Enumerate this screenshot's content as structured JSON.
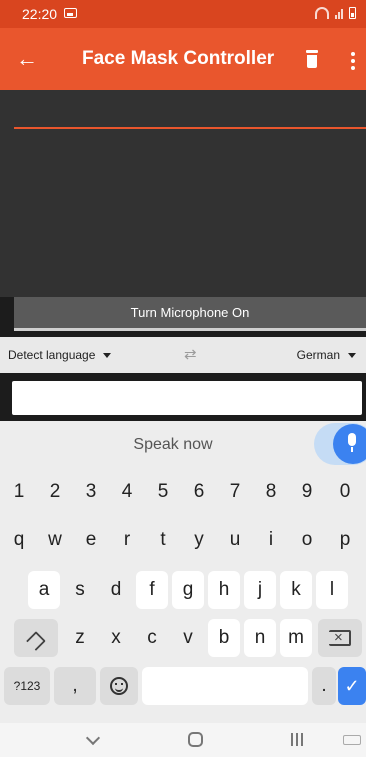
{
  "status_bar": {
    "time": "22:20"
  },
  "app_bar": {
    "title": "Face Mask Controller"
  },
  "mic_button": {
    "label": "Turn Microphone On"
  },
  "language_bar": {
    "source": "Detect language",
    "target": "German"
  },
  "keyboard": {
    "voice_prompt": "Speak now",
    "number_row": [
      "1",
      "2",
      "3",
      "4",
      "5",
      "6",
      "7",
      "8",
      "9",
      "0"
    ],
    "row1": [
      "q",
      "w",
      "e",
      "r",
      "t",
      "y",
      "u",
      "i",
      "o",
      "p"
    ],
    "row2": [
      "a",
      "s",
      "d",
      "f",
      "g",
      "h",
      "j",
      "k",
      "l"
    ],
    "row3": [
      "z",
      "x",
      "c",
      "v",
      "b",
      "n",
      "m"
    ],
    "symbols_key": "?123",
    "comma_key": ",",
    "period_key": ".",
    "enter_glyph": "✓"
  }
}
